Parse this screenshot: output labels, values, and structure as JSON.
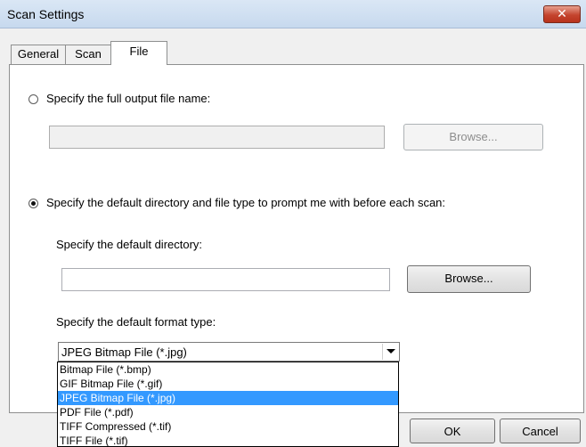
{
  "window": {
    "title": "Scan Settings",
    "close_glyph": "✕"
  },
  "tabs": [
    {
      "label": "General"
    },
    {
      "label": "Scan"
    },
    {
      "label": "File"
    }
  ],
  "file_tab": {
    "option_full_name": {
      "label": "Specify the full output file name:",
      "checked": false,
      "input_value": "",
      "browse_label": "Browse...",
      "enabled": false
    },
    "option_default_dir": {
      "label": "Specify the default directory and file type to prompt me with before each scan:",
      "checked": true,
      "directory_label": "Specify the default directory:",
      "directory_value": "",
      "browse_label": "Browse...",
      "format_label": "Specify the default format type:",
      "format_selected": "JPEG Bitmap File  (*.jpg)",
      "format_options": [
        "Bitmap File  (*.bmp)",
        "GIF Bitmap File  (*.gif)",
        "JPEG Bitmap File  (*.jpg)",
        "PDF File  (*.pdf)",
        "TIFF Compressed  (*.tif)",
        "TIFF File  (*.tif)"
      ],
      "format_highlighted_index": 2
    }
  },
  "footer": {
    "ok_label": "OK",
    "cancel_label": "Cancel"
  }
}
